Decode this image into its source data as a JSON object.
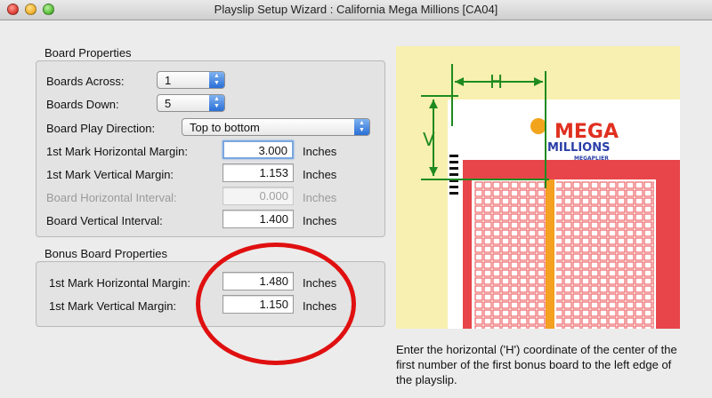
{
  "window": {
    "title": "Playslip Setup Wizard : California Mega Millions [CA04]"
  },
  "board_properties": {
    "title": "Board Properties",
    "boards_across": {
      "label": "Boards Across:",
      "value": "1"
    },
    "boards_down": {
      "label": "Boards Down:",
      "value": "5"
    },
    "play_direction": {
      "label": "Board Play Direction:",
      "value": "Top to bottom"
    },
    "h_margin": {
      "label": "1st Mark Horizontal Margin:",
      "value": "3.000",
      "unit": "Inches"
    },
    "v_margin": {
      "label": "1st Mark Vertical Margin:",
      "value": "1.153",
      "unit": "Inches"
    },
    "h_interval": {
      "label": "Board Horizontal Interval:",
      "value": "0.000",
      "unit": "Inches"
    },
    "v_interval": {
      "label": "Board Vertical Interval:",
      "value": "1.400",
      "unit": "Inches"
    }
  },
  "bonus_board_properties": {
    "title": "Bonus Board Properties",
    "h_margin": {
      "label": "1st Mark Horizontal Margin:",
      "value": "1.480",
      "unit": "Inches"
    },
    "v_margin": {
      "label": "1st Mark Vertical Margin:",
      "value": "1.150",
      "unit": "Inches"
    }
  },
  "diagram": {
    "h_label": "H",
    "v_label": "V",
    "logo_top": "MEGA",
    "logo_bottom": "MILLIONS",
    "logo_sub": "MEGAPLIER"
  },
  "description": "Enter the horizontal ('H') coordinate of the center of the first number of the first bonus board to the left edge of the playslip.",
  "colors": {
    "guide_green": "#1f8a1f",
    "highlight_red": "#e01010",
    "slip_red": "#e8454a"
  }
}
